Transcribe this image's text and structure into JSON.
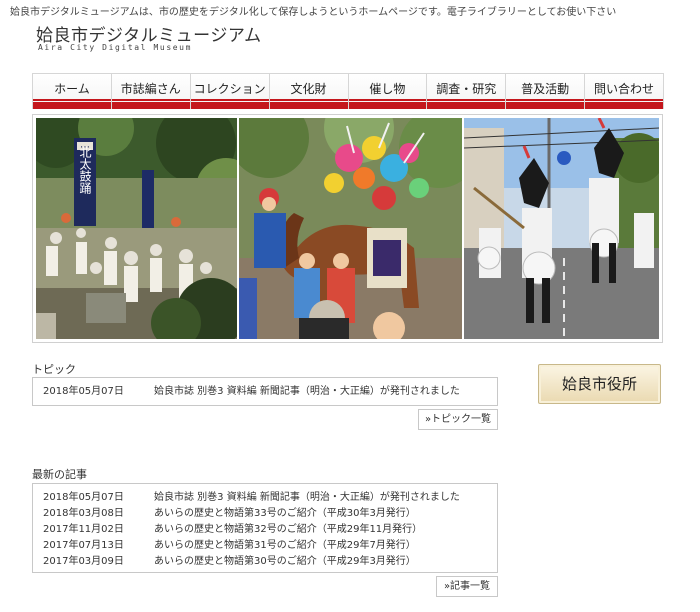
{
  "site": {
    "tagline": "姶良市デジタルミュージアムは、市の歴史をデジタル化して保存しようというホームページです。電子ライブラリーとしてお使い下さい",
    "title": "姶良市デジタルミュージアム",
    "subtitle": "Aira City Digital Museum"
  },
  "nav": {
    "items": [
      {
        "label": "ホーム"
      },
      {
        "label": "市誌編さん"
      },
      {
        "label": "コレクション"
      },
      {
        "label": "文化財"
      },
      {
        "label": "催し物"
      },
      {
        "label": "調査・研究"
      },
      {
        "label": "普及活動"
      },
      {
        "label": "問い合わせ"
      }
    ]
  },
  "hero": {
    "banner_text": "北太鼓踊"
  },
  "topics": {
    "heading": "トピック",
    "items": [
      {
        "date": "2018年05月07日",
        "title": "姶良市誌 別巻3 資料編 新聞記事（明治・大正編）が発刊されました"
      }
    ],
    "more_label": "»トピック一覧"
  },
  "articles": {
    "heading": "最新の記事",
    "items": [
      {
        "date": "2018年05月07日",
        "title": "姶良市誌 別巻3 資料編 新聞記事（明治・大正編）が発刊されました"
      },
      {
        "date": "2018年03月08日",
        "title": "あいらの歴史と物語第33号のご紹介（平成30年3月発行）"
      },
      {
        "date": "2017年11月02日",
        "title": "あいらの歴史と物語第32号のご紹介（平成29年11月発行）"
      },
      {
        "date": "2017年07月13日",
        "title": "あいらの歴史と物語第31号のご紹介（平成29年7月発行）"
      },
      {
        "date": "2017年03月09日",
        "title": "あいらの歴史と物語第30号のご紹介（平成29年3月発行）"
      }
    ],
    "more_label": "»記事一覧"
  },
  "sidebar": {
    "city_hall_label": "姶良市役所"
  },
  "colors": {
    "nav_accent": "#c4161c",
    "city_button": "#ead9b0"
  }
}
